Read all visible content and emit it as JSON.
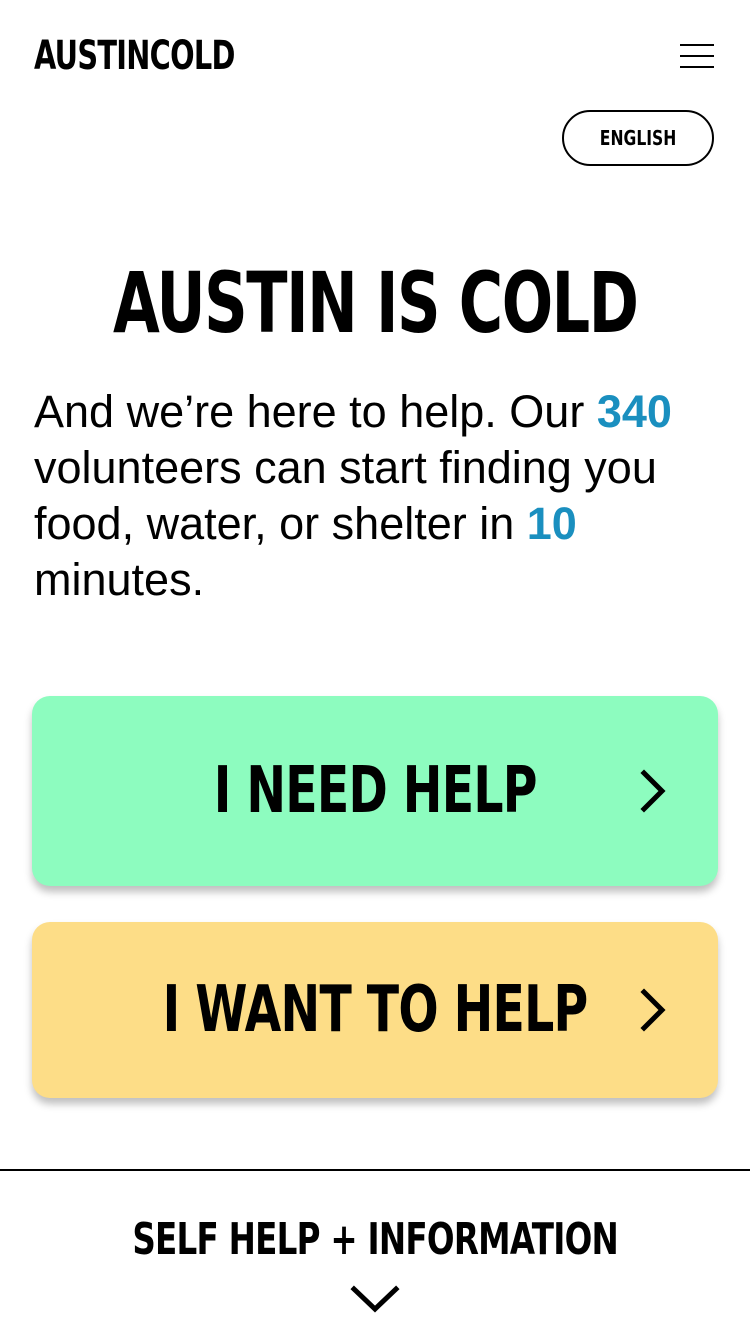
{
  "header": {
    "logo_text": "AUSTINCOLD",
    "menu_icon": "hamburger-menu-icon",
    "language_label": "ENGLISH"
  },
  "hero": {
    "title": "AUSTIN IS COLD",
    "intro_part1": "And we’re here to help. Our ",
    "volunteer_count": "340",
    "intro_part2": " volunteers can start finding you food, water, or shelter in ",
    "minutes_count": "10",
    "intro_part3": " minutes."
  },
  "actions": {
    "need_help_label": "I NEED HELP",
    "want_to_help_label": "I WANT TO HELP",
    "chevron_icon": "chevron-right-icon"
  },
  "footer": {
    "self_help_label": "SELF HELP + INFORMATION",
    "expand_icon": "chevron-down-icon"
  },
  "colors": {
    "need_help_bg": "#8dfcbf",
    "want_to_help_bg": "#fddd87",
    "accent_number": "#1a8fbf"
  }
}
